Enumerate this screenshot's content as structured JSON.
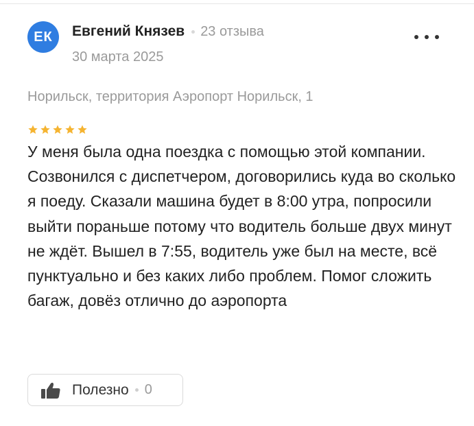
{
  "review": {
    "avatar_initials": "ЕК",
    "author_name": "Евгений Князев",
    "reviews_count": "23 отзыва",
    "date": "30 марта 2025",
    "address": "Норильск, территория Аэропорт Норильск, 1",
    "rating": 5,
    "text": "У меня была одна поездка с помощью этой компании. Созвонился с диспетчером, договорились куда во сколько я поеду. Сказали машина будет в 8:00 утра, попросили выйти пораньше потому что водитель больше двух минут не ждёт. Вышел в 7:55, водитель уже был на месте, всё пунктуально и без каких либо проблем. Помог сложить багаж, довёз отлично до аэропорта",
    "useful_label": "Полезно",
    "useful_count": "0"
  },
  "icons": {
    "more": "more-horizontal-icon",
    "star": "star-icon",
    "thumb": "thumbs-up-icon"
  },
  "colors": {
    "avatar_bg": "#2f7de1",
    "star": "#f5b431",
    "muted_text": "#9a9a9a",
    "main_text": "#222222"
  }
}
